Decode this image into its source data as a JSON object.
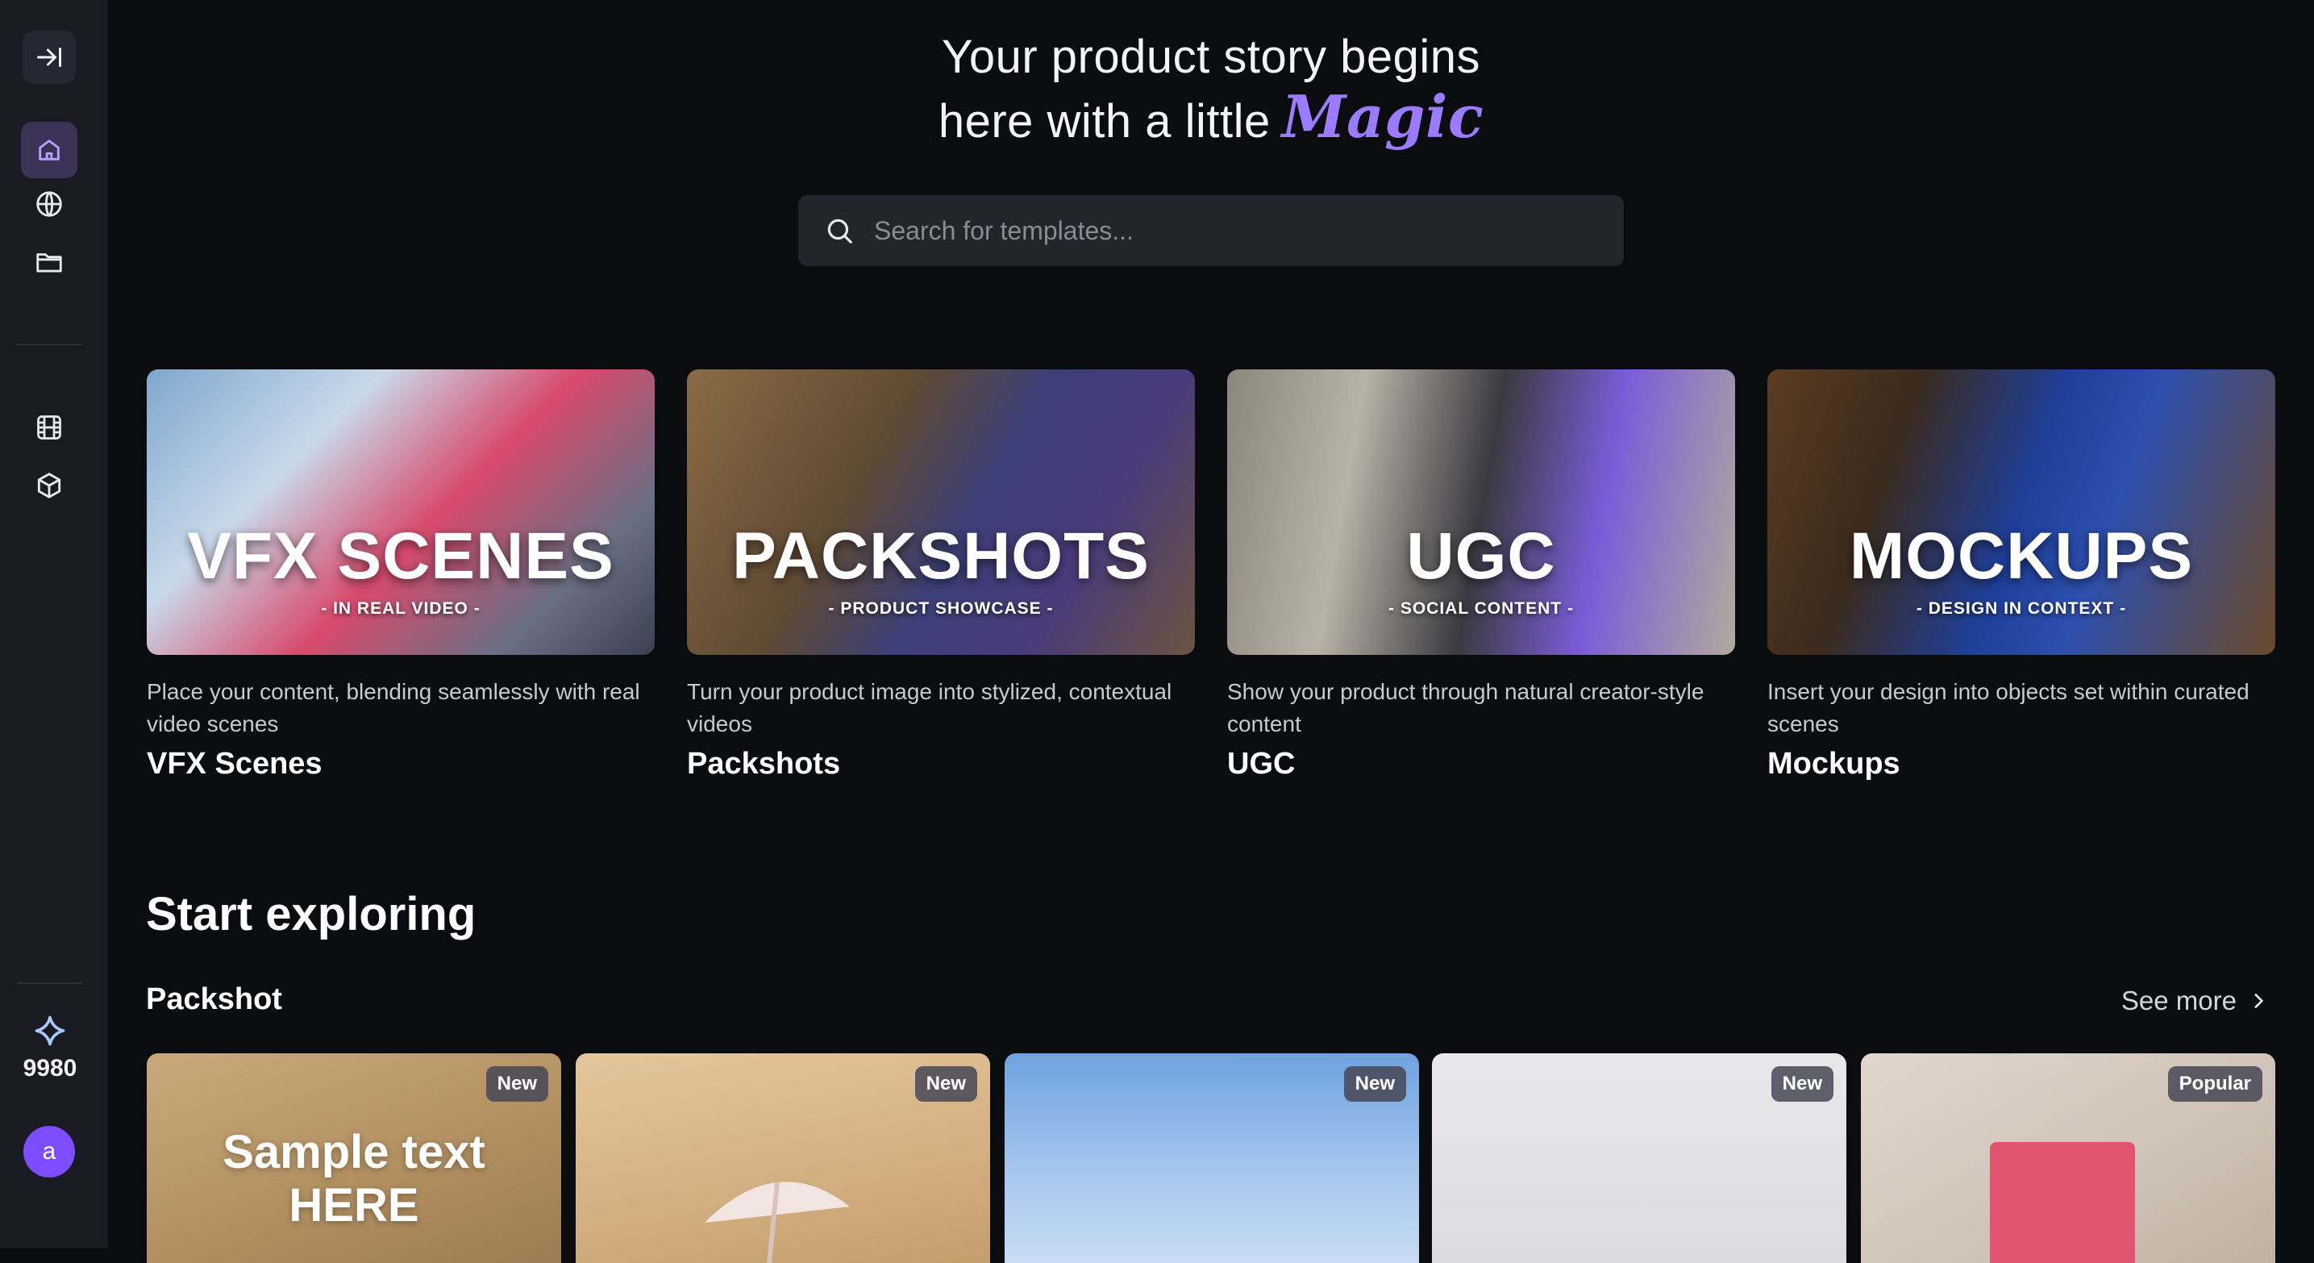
{
  "sidebar": {
    "credits": "9980",
    "avatar_initial": "a"
  },
  "hero": {
    "line1": "Your product story begins",
    "line2": "here with a little",
    "magic": "Magic"
  },
  "search": {
    "placeholder": "Search for templates..."
  },
  "categories": [
    {
      "big": "VFX SCENES",
      "tag": "- IN REAL VIDEO -",
      "desc": "Place your content, blending seamlessly with real video scenes",
      "name": "VFX Scenes"
    },
    {
      "big": "PACKSHOTS",
      "tag": "- PRODUCT SHOWCASE -",
      "desc": "Turn your product image into stylized, contextual videos",
      "name": "Packshots"
    },
    {
      "big": "UGC",
      "tag": "- SOCIAL CONTENT -",
      "desc": "Show your product through natural creator-style content",
      "name": "UGC"
    },
    {
      "big": "MOCKUPS",
      "tag": "- DESIGN IN CONTEXT -",
      "desc": "Insert your design into objects set within curated scenes",
      "name": "Mockups"
    }
  ],
  "explore": {
    "title": "Start exploring",
    "subsection": "Packshot",
    "see_more": "See more"
  },
  "templates": [
    {
      "badge": "New",
      "sample_line1": "Sample text",
      "sample_line2": "HERE"
    },
    {
      "badge": "New"
    },
    {
      "badge": "New"
    },
    {
      "badge": "New"
    },
    {
      "badge": "Popular"
    }
  ]
}
